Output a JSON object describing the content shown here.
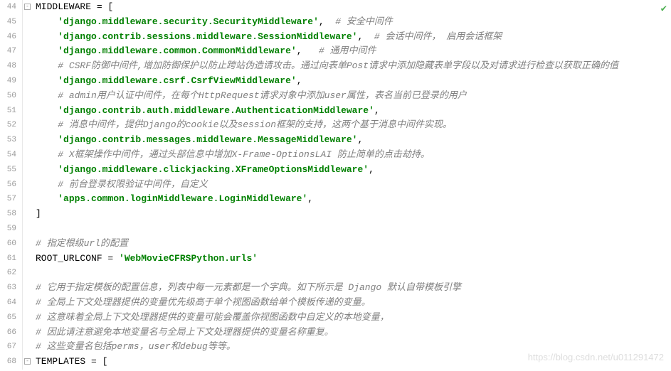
{
  "watermark": "https://blog.csdn.net/u011291472",
  "startLine": 44,
  "lines": [
    {
      "num": 44,
      "fold": "close-start",
      "segs": [
        {
          "t": "MIDDLEWARE ",
          "c": "kw"
        },
        {
          "t": "= [",
          "c": "punct"
        }
      ]
    },
    {
      "num": 45,
      "segs": [
        {
          "t": "    ",
          "c": ""
        },
        {
          "t": "'django.middleware.security.SecurityMiddleware'",
          "c": "str"
        },
        {
          "t": ",  ",
          "c": "punct"
        },
        {
          "t": "# 安全中间件",
          "c": "cmt"
        }
      ]
    },
    {
      "num": 46,
      "segs": [
        {
          "t": "    ",
          "c": ""
        },
        {
          "t": "'django.contrib.sessions.middleware.SessionMiddleware'",
          "c": "str"
        },
        {
          "t": ",  ",
          "c": "punct"
        },
        {
          "t": "# 会话中间件， 启用会话框架",
          "c": "cmt"
        }
      ]
    },
    {
      "num": 47,
      "segs": [
        {
          "t": "    ",
          "c": ""
        },
        {
          "t": "'django.middleware.common.CommonMiddleware'",
          "c": "str"
        },
        {
          "t": ",   ",
          "c": "punct"
        },
        {
          "t": "# 通用中间件",
          "c": "cmt"
        }
      ]
    },
    {
      "num": 48,
      "segs": [
        {
          "t": "    ",
          "c": ""
        },
        {
          "t": "# CSRF防御中间件,增加防御保护以防止跨站伪造请攻击。通过向表单Post请求中添加隐藏表单字段以及对请求进行检查以获取正确的值",
          "c": "cmt"
        }
      ]
    },
    {
      "num": 49,
      "segs": [
        {
          "t": "    ",
          "c": ""
        },
        {
          "t": "'django.middleware.csrf.CsrfViewMiddleware'",
          "c": "str"
        },
        {
          "t": ",",
          "c": "punct"
        }
      ]
    },
    {
      "num": 50,
      "segs": [
        {
          "t": "    ",
          "c": ""
        },
        {
          "t": "# admin用户认证中间件，在每个HttpRequest请求对象中添加user属性，表名当前已登录的用户",
          "c": "cmt"
        }
      ]
    },
    {
      "num": 51,
      "segs": [
        {
          "t": "    ",
          "c": ""
        },
        {
          "t": "'django.contrib.auth.middleware.AuthenticationMiddleware'",
          "c": "str"
        },
        {
          "t": ",",
          "c": "punct"
        }
      ]
    },
    {
      "num": 52,
      "segs": [
        {
          "t": "    ",
          "c": ""
        },
        {
          "t": "# 消息中间件，提供Django的cookie以及session框架的支持，这两个基于消息中间件实现。",
          "c": "cmt"
        }
      ]
    },
    {
      "num": 53,
      "segs": [
        {
          "t": "    ",
          "c": ""
        },
        {
          "t": "'django.contrib.messages.middleware.MessageMiddleware'",
          "c": "str"
        },
        {
          "t": ",",
          "c": "punct"
        }
      ]
    },
    {
      "num": 54,
      "segs": [
        {
          "t": "    ",
          "c": ""
        },
        {
          "t": "# X框架操作中间件，通过头部信息中增加X-Frame-OptionsLAI 防止简单的点击劫持。",
          "c": "cmt"
        }
      ]
    },
    {
      "num": 55,
      "segs": [
        {
          "t": "    ",
          "c": ""
        },
        {
          "t": "'django.middleware.clickjacking.XFrameOptionsMiddleware'",
          "c": "str"
        },
        {
          "t": ",",
          "c": "punct"
        }
      ]
    },
    {
      "num": 56,
      "segs": [
        {
          "t": "    ",
          "c": ""
        },
        {
          "t": "# 前台登录权限验证中间件，自定义",
          "c": "cmt"
        }
      ]
    },
    {
      "num": 57,
      "segs": [
        {
          "t": "    ",
          "c": ""
        },
        {
          "t": "'apps.common.loginMiddleware.LoginMiddleware'",
          "c": "str"
        },
        {
          "t": ",",
          "c": "punct"
        }
      ]
    },
    {
      "num": 58,
      "fold": "end",
      "segs": [
        {
          "t": "]",
          "c": "punct"
        }
      ]
    },
    {
      "num": 59,
      "segs": [
        {
          "t": "",
          "c": ""
        }
      ]
    },
    {
      "num": 60,
      "segs": [
        {
          "t": "# 指定根级url的配置",
          "c": "cmt"
        }
      ]
    },
    {
      "num": 61,
      "segs": [
        {
          "t": "ROOT_URLCONF ",
          "c": "kw"
        },
        {
          "t": "= ",
          "c": "punct"
        },
        {
          "t": "'WebMovieCFRSPython.urls'",
          "c": "str"
        }
      ]
    },
    {
      "num": 62,
      "segs": [
        {
          "t": "",
          "c": ""
        }
      ]
    },
    {
      "num": 63,
      "segs": [
        {
          "t": "# 它用于指定模板的配置信息，列表中每一元素都是一个字典。如下所示是 Django 默认自带模板引擎",
          "c": "cmt"
        }
      ]
    },
    {
      "num": 64,
      "segs": [
        {
          "t": "# 全局上下文处理器提供的变量优先级高于单个视图函数给单个模板传递的变量。",
          "c": "cmt"
        }
      ]
    },
    {
      "num": 65,
      "segs": [
        {
          "t": "# 这意味着全局上下文处理器提供的变量可能会覆盖你视图函数中自定义的本地变量，",
          "c": "cmt"
        }
      ]
    },
    {
      "num": 66,
      "segs": [
        {
          "t": "# 因此请注意避免本地变量名与全局上下文处理器提供的变量名称重复。",
          "c": "cmt"
        }
      ]
    },
    {
      "num": 67,
      "segs": [
        {
          "t": "# 这些变量名包括perms，user和debug等等。",
          "c": "cmt"
        }
      ]
    },
    {
      "num": 68,
      "fold": "open-start",
      "segs": [
        {
          "t": "TEMPLATES ",
          "c": "kw"
        },
        {
          "t": "= [",
          "c": "punct"
        }
      ]
    }
  ]
}
